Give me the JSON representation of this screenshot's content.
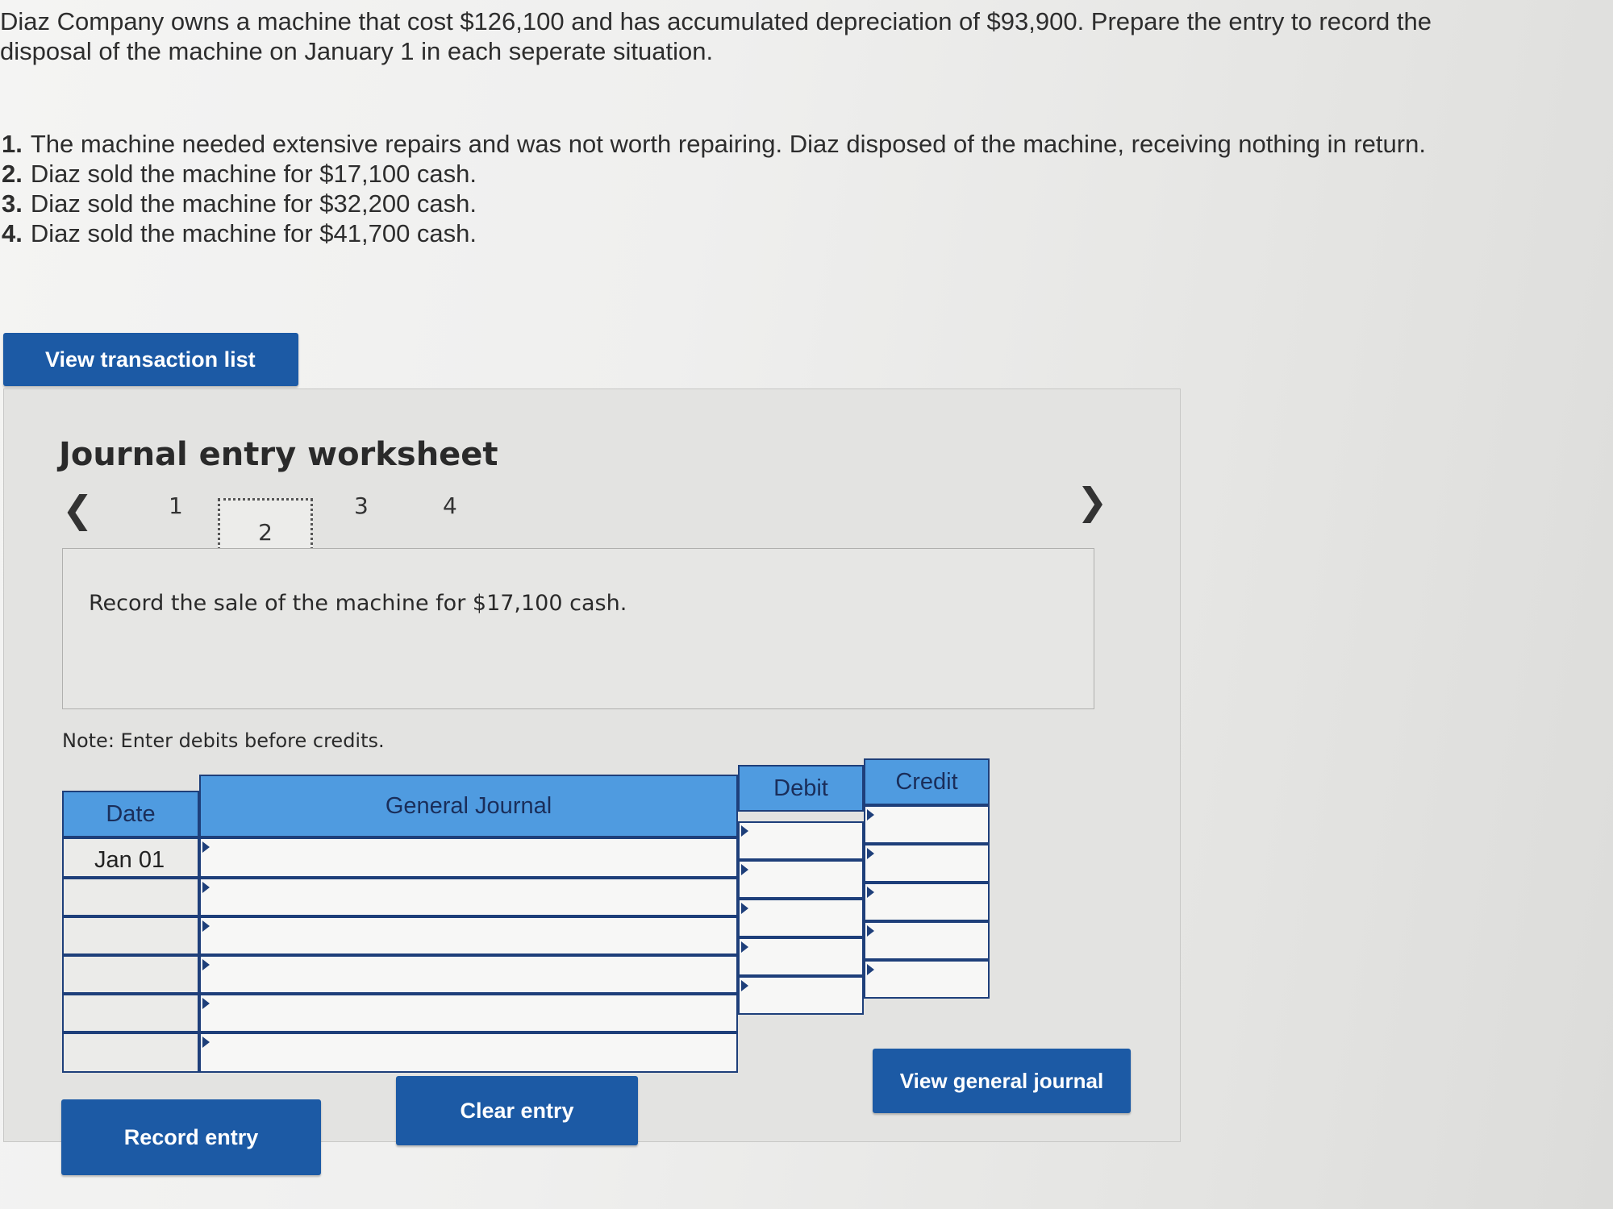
{
  "problem": {
    "line1": "Diaz Company owns a machine that cost $126,100 and has accumulated depreciation of $93,900. Prepare the entry to record the",
    "line2": "disposal of the machine on January 1 in each seperate situation."
  },
  "situations": [
    {
      "num": "1.",
      "text": "The machine needed extensive repairs and was not worth repairing. Diaz disposed of the machine, receiving nothing in return."
    },
    {
      "num": "2.",
      "text": "Diaz sold the machine for $17,100 cash."
    },
    {
      "num": "3.",
      "text": "Diaz sold the machine for $32,200 cash."
    },
    {
      "num": "4.",
      "text": "Diaz sold the machine for $41,700 cash."
    }
  ],
  "buttons": {
    "view_transaction_list": "View transaction list",
    "record_entry": "Record entry",
    "clear_entry": "Clear entry",
    "view_general_journal": "View general journal"
  },
  "worksheet": {
    "title": "Journal entry worksheet",
    "tabs": [
      "1",
      "2",
      "3",
      "4"
    ],
    "active_tab": "2",
    "prompt": "Record the sale of the machine for $17,100 cash.",
    "note": "Note: Enter debits before credits.",
    "columns": {
      "date": "Date",
      "general_journal": "General Journal",
      "debit": "Debit",
      "credit": "Credit"
    },
    "rows": [
      {
        "date": "Jan 01"
      },
      {
        "date": ""
      },
      {
        "date": ""
      },
      {
        "date": ""
      },
      {
        "date": ""
      },
      {
        "date": ""
      }
    ]
  },
  "colors": {
    "button_blue": "#1c5aa5",
    "header_blue": "#4f9be0",
    "border_navy": "#1e3f7a"
  },
  "icons": {
    "prev": "chevron-left-icon",
    "next": "chevron-right-icon"
  }
}
